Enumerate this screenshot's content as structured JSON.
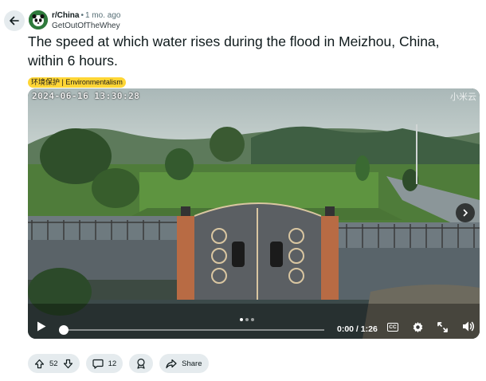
{
  "post": {
    "subreddit": "r/China",
    "time": "1 mo. ago",
    "author": "GetOutOfTheWhey",
    "title": "The speed at which water rises during the flood in Meizhou, China, within 6 hours.",
    "flair": "环境保护 | Environmentalism"
  },
  "video": {
    "timestamp_overlay": "2024-06-16  13:30:28",
    "watermark": "小米云",
    "time_readout": "0:00 / 1:26",
    "cc_label": "CC",
    "progress_fraction": 0.0,
    "page_count": 3,
    "active_page": 0
  },
  "actions": {
    "upvotes": "52",
    "comments": "12",
    "share_label": "Share"
  },
  "icons": [
    "back-arrow-icon",
    "subreddit-avatar-icon",
    "play-icon",
    "captions-icon",
    "settings-gear-icon",
    "fullscreen-icon",
    "volume-icon",
    "next-chevron-icon",
    "upvote-icon",
    "downvote-icon",
    "comment-icon",
    "award-icon",
    "share-icon"
  ],
  "colors": {
    "flair": "#ffd635",
    "pill_bg": "#e5ebee",
    "text": "#0f1a1c"
  }
}
